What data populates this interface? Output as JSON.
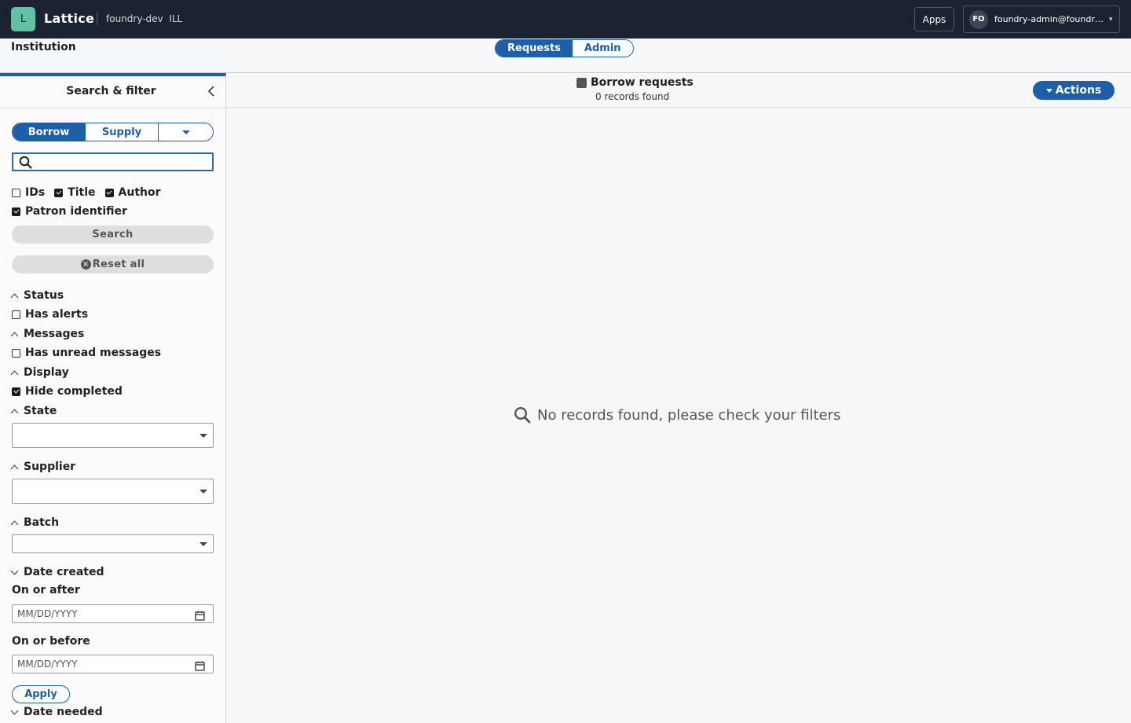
{
  "topbar": {
    "logo_letter": "L",
    "app_name": "Lattice",
    "tenant": "foundry-dev  ILL",
    "apps_label": "Apps",
    "avatar_initials": "FO",
    "user_email": "foundry-admin@foundry-l...",
    "user_caret": "▾"
  },
  "subheader": {
    "title": "Institution",
    "nav": [
      {
        "label": "Requests",
        "active": true
      },
      {
        "label": "Admin",
        "active": false
      }
    ]
  },
  "sidebar": {
    "title": "Search & filter",
    "collapse_icon": "chevron-left-icon",
    "mode_tabs": [
      {
        "label": "Borrow",
        "active": true
      },
      {
        "label": "Supply",
        "active": false
      }
    ],
    "search": {
      "value": "",
      "placeholder": ""
    },
    "search_fields": [
      {
        "label": "IDs",
        "checked": false
      },
      {
        "label": "Title",
        "checked": true
      },
      {
        "label": "Author",
        "checked": true
      },
      {
        "label": "Patron identifier",
        "checked": true
      }
    ],
    "search_button": "Search",
    "reset_button": "Reset all",
    "sections": {
      "status": {
        "title": "Status",
        "option": "Has alerts",
        "checked": false
      },
      "messages": {
        "title": "Messages",
        "option": "Has unread messages",
        "checked": false
      },
      "display": {
        "title": "Display",
        "option": "Hide completed",
        "checked": true
      },
      "state": {
        "title": "State",
        "value": ""
      },
      "supplier": {
        "title": "Supplier",
        "value": ""
      },
      "batch": {
        "title": "Batch",
        "value": ""
      },
      "date_created": {
        "title": "Date created",
        "after_label": "On or after",
        "after_placeholder": "MM/DD/YYYY",
        "before_label": "On or before",
        "before_placeholder": "MM/DD/YYYY",
        "apply": "Apply"
      },
      "date_needed": {
        "title": "Date needed"
      }
    }
  },
  "main": {
    "title": "Borrow requests",
    "count": "0 records found",
    "actions_label": "Actions",
    "empty_message": "No records found, please check your filters"
  },
  "colors": {
    "topbar_bg": "#1b2333",
    "accent": "#1d5fa8",
    "logo_bg": "#62c0a4"
  }
}
